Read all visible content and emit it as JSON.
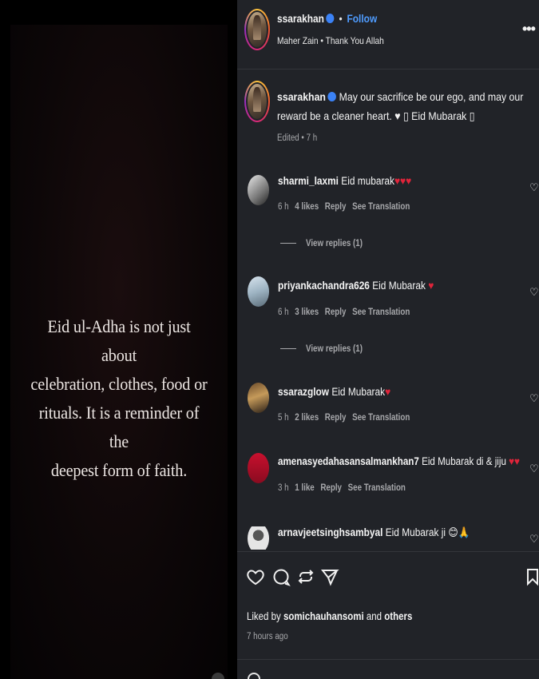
{
  "media": {
    "text": "Eid ul-Adha is not just about\ncelebration, clothes, food or\nrituals. It is a reminder of the\ndeepest form of faith."
  },
  "header": {
    "username": "ssarakhan",
    "separator": "•",
    "follow_label": "Follow",
    "audio": "Maher Zain • Thank You Allah",
    "more_icon": "more-horizontal-icon"
  },
  "caption": {
    "username": "ssarakhan",
    "text": "May our sacrifice be our ego, and may our reward be a cleaner heart. ♥ ▯ Eid Mubarak ▯",
    "meta": "Edited • 7 h"
  },
  "comments": [
    {
      "username": "sharmi_laxmi",
      "text": "Eid mubarak",
      "emoji": "♥♥♥",
      "time": "6 h",
      "likes": "4 likes",
      "reply": "Reply",
      "translate": "See Translation",
      "view_replies": "View replies (1)"
    },
    {
      "username": "priyankachandra626",
      "text": "Eid Mubarak",
      "emoji": "♥",
      "time": "6 h",
      "likes": "3 likes",
      "reply": "Reply",
      "translate": "See Translation",
      "view_replies": "View replies (1)"
    },
    {
      "username": "ssarazglow",
      "text": "Eid Mubarak",
      "emoji": "♥",
      "time": "5 h",
      "likes": "2 likes",
      "reply": "Reply",
      "translate": "See Translation"
    },
    {
      "username": "amenasyedahasansalmankhan7",
      "text": "Eid Mubarak di & jiju",
      "emoji": "♥♥",
      "time": "3 h",
      "likes": "1 like",
      "reply": "Reply",
      "translate": "See Translation"
    },
    {
      "username": "arnavjeetsinghsambyal",
      "text": "Eid Mubarak ji",
      "emoji": "😊🙏"
    }
  ],
  "actions": {
    "like_icon": "heart-icon",
    "comment_icon": "comment-icon",
    "repost_icon": "repost-icon",
    "share_icon": "share-icon",
    "save_icon": "bookmark-icon"
  },
  "liked_by": {
    "prefix": "Liked by",
    "user": "somichauhansomi",
    "and": "and",
    "others": "others"
  },
  "time_ago": "7 hours ago",
  "colors": {
    "panel": "#212328",
    "follow": "#4f9cff",
    "verified": "#3b82f6",
    "heart": "#e0243a"
  }
}
